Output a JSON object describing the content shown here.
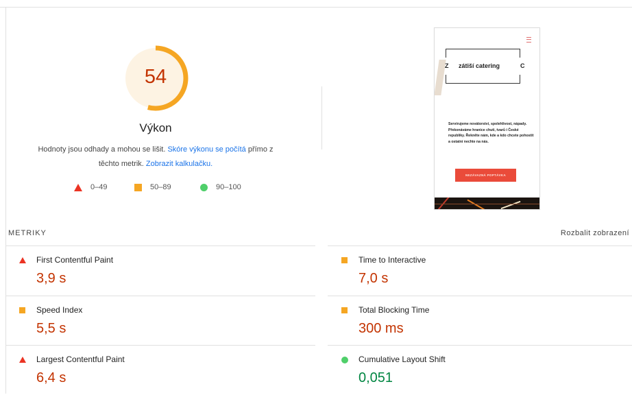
{
  "summary": {
    "score": "54",
    "score_value": 54,
    "title": "Výkon",
    "desc_part1": "Hodnoty jsou odhady a mohou se lišit. ",
    "desc_link1": "Skóre výkonu se počítá",
    "desc_part2": " přímo z těchto metrik. ",
    "desc_link2": "Zobrazit kalkulačku.",
    "colors": {
      "score_ring": "#f5a623",
      "score_bg": "#fdf3e3",
      "score_text": "#c33300"
    }
  },
  "legend": [
    {
      "icon": "triangle-red-icon",
      "label": "0–49"
    },
    {
      "icon": "square-orange-icon",
      "label": "50–89"
    },
    {
      "icon": "circle-green-icon",
      "label": "90–100"
    }
  ],
  "screenshot": {
    "logo_left": "Z",
    "logo_text": "zátiší catering",
    "logo_right": "C",
    "copy": "Servírujeme novátorství, spolehlivost, nápady. Překonáváme hranice chuti, tvarů i České republiky. Řekněte nám, kde a kdo chcete pohostit a ostatní nechte na nás.",
    "cta": "NEZÁVAZNÁ POPTÁVKA"
  },
  "metrics": {
    "section_title": "METRIKY",
    "toggle_label": "Rozbalit zobrazení",
    "items": [
      {
        "name": "First Contentful Paint",
        "value": "3,9 s",
        "status": "bad"
      },
      {
        "name": "Time to Interactive",
        "value": "7,0 s",
        "status": "average"
      },
      {
        "name": "Speed Index",
        "value": "5,5 s",
        "status": "average"
      },
      {
        "name": "Total Blocking Time",
        "value": "300 ms",
        "status": "average"
      },
      {
        "name": "Largest Contentful Paint",
        "value": "6,4 s",
        "status": "bad"
      },
      {
        "name": "Cumulative Layout Shift",
        "value": "0,051",
        "status": "good"
      }
    ]
  }
}
